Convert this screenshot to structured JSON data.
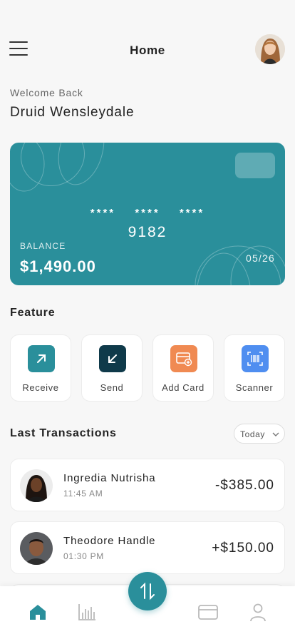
{
  "header": {
    "title": "Home",
    "menu_icon": "hamburger-menu-icon",
    "avatar": "user-avatar"
  },
  "welcome": {
    "greeting": "Welcome Back",
    "name": "Druid Wensleydale"
  },
  "card": {
    "masked_groups": [
      "****",
      "****",
      "****"
    ],
    "last_digits": "9182",
    "balance_label": "BALANCE",
    "balance": "$1,490.00",
    "expiry": "05/26",
    "color": "#2a8f9b"
  },
  "features": {
    "title": "Feature",
    "items": [
      {
        "label": "Receive",
        "icon": "arrow-up-right-icon",
        "color": "#2a8f9b"
      },
      {
        "label": "Send",
        "icon": "arrow-down-left-icon",
        "color": "#0f3a4a"
      },
      {
        "label": "Add Card",
        "icon": "add-card-icon",
        "color": "#f08a52"
      },
      {
        "label": "Scanner",
        "icon": "barcode-scanner-icon",
        "color": "#4f8ef0"
      }
    ]
  },
  "transactions": {
    "title": "Last Transactions",
    "filter": "Today",
    "items": [
      {
        "name": "Ingredia Nutrisha",
        "time": "11:45 AM",
        "amount": "-$385.00"
      },
      {
        "name": "Theodore Handle",
        "time": "01:30 PM",
        "amount": "+$150.00"
      }
    ]
  },
  "bottom_nav": {
    "items": [
      "home-icon",
      "stats-chart-icon",
      "transfer-icon",
      "card-icon",
      "profile-icon"
    ],
    "active": "home-icon"
  }
}
